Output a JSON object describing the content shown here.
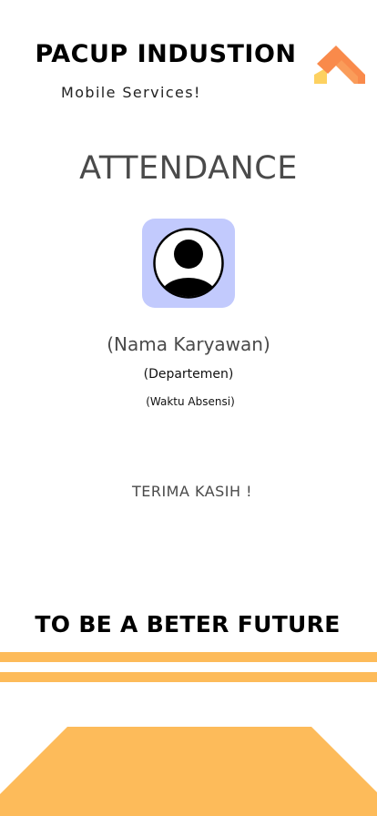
{
  "header": {
    "brand_title": "PACUP INDUSTION",
    "brand_subtitle": "Mobile Services!"
  },
  "main": {
    "title": "ATTENDANCE",
    "employee_name": "(Nama Karyawan)",
    "department": "(Departemen)",
    "attendance_time": "(Waktu Absensi)",
    "thanks": "TERIMA KASIH !"
  },
  "footer": {
    "tagline": "TO BE A BETER FUTURE"
  },
  "icons": {
    "logo": "chevron-roof-logo",
    "avatar": "user-circle-icon"
  },
  "colors": {
    "accent": "#fdbb5a",
    "logo_orange": "#f98a4b",
    "logo_yellow": "#fdd160",
    "avatar_bg": "#c2cafd"
  }
}
